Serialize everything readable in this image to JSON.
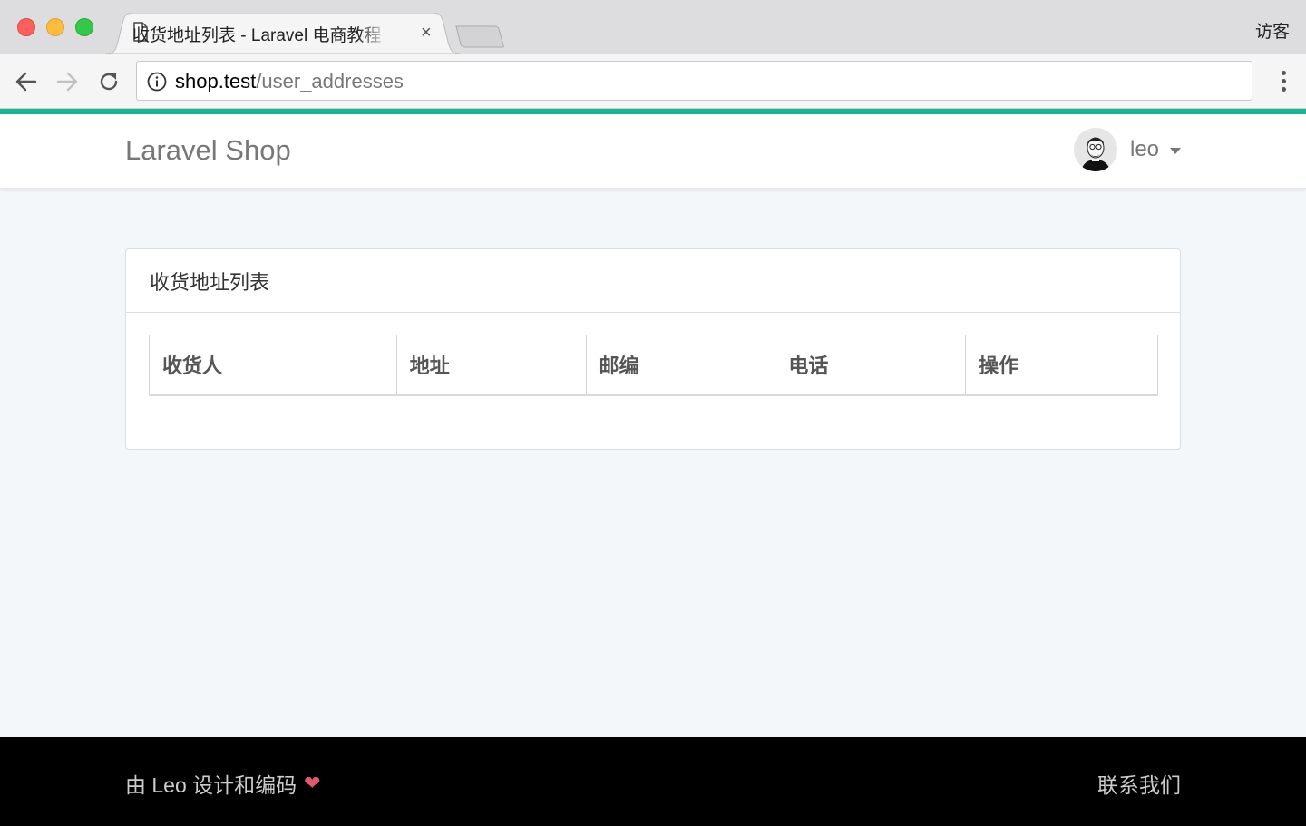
{
  "browser": {
    "tab_title": "收货地址列表 - Laravel 电商教程",
    "tab_close": "×",
    "guest_label": "访客",
    "url_host": "shop.test",
    "url_path": "/user_addresses"
  },
  "navbar": {
    "brand": "Laravel Shop",
    "user_name": "leo"
  },
  "panel": {
    "title": "收货地址列表",
    "columns": [
      "收货人",
      "地址",
      "邮编",
      "电话",
      "操作"
    ]
  },
  "footer": {
    "credit": "由 Leo 设计和编码",
    "heart": "❤",
    "contact": "联系我们"
  },
  "colors": {
    "accent": "#1ab394",
    "footer_bg": "#000000",
    "page_bg": "#f4f7fa"
  }
}
